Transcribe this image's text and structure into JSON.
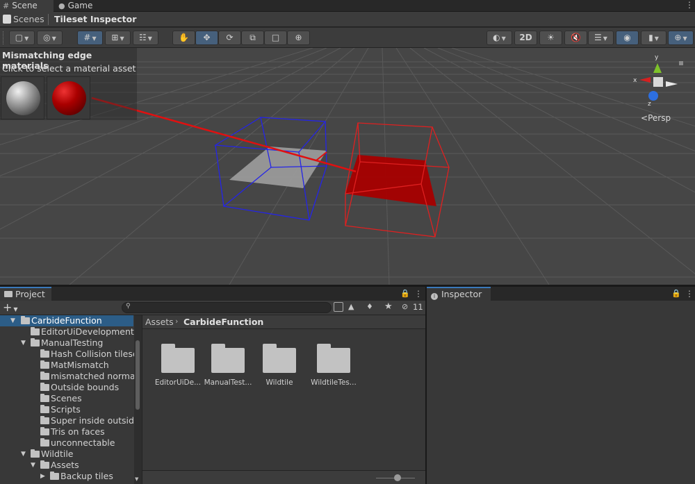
{
  "top_tabs": [
    {
      "label": "Scene",
      "icon": "grid-icon"
    },
    {
      "label": "Game",
      "icon": "gamepad-icon"
    }
  ],
  "breadcrumb": {
    "root": "Scenes",
    "current": "Tileset Inspector"
  },
  "toolbar": {
    "two_d_label": "2D"
  },
  "scene": {
    "overlay_title": "Mismatching edge materials",
    "overlay_subtitle": "Click to select a material asset",
    "persp_label": "Persp",
    "gizmo_axes": {
      "x": "x",
      "y": "y",
      "z": "z"
    },
    "colors": {
      "grid_bg": "#444444",
      "blue_box": "#2020e0",
      "red_box": "#e01a1a",
      "gray_face": "#9a9a9a",
      "red_face": "#b00000"
    }
  },
  "project": {
    "tab_label": "Project",
    "search_placeholder": "",
    "hidden_count": "11",
    "tree": [
      {
        "label": "CarbideFunction",
        "depth": 0,
        "arrow": "expanded",
        "selected": true
      },
      {
        "label": "EditorUiDevelopment",
        "depth": 1,
        "arrow": "none"
      },
      {
        "label": "ManualTesting",
        "depth": 1,
        "arrow": "expanded"
      },
      {
        "label": "Hash Collision tileset",
        "depth": 2,
        "arrow": "none"
      },
      {
        "label": "MatMismatch",
        "depth": 2,
        "arrow": "none"
      },
      {
        "label": "mismatched normals",
        "depth": 2,
        "arrow": "none"
      },
      {
        "label": "Outside bounds",
        "depth": 2,
        "arrow": "none"
      },
      {
        "label": "Scenes",
        "depth": 2,
        "arrow": "none"
      },
      {
        "label": "Scripts",
        "depth": 2,
        "arrow": "none"
      },
      {
        "label": "Super inside outside",
        "depth": 2,
        "arrow": "none"
      },
      {
        "label": "Tris on faces",
        "depth": 2,
        "arrow": "none"
      },
      {
        "label": "unconnectable",
        "depth": 2,
        "arrow": "none"
      },
      {
        "label": "Wildtile",
        "depth": 1,
        "arrow": "expanded"
      },
      {
        "label": "Assets",
        "depth": 2,
        "arrow": "expanded"
      },
      {
        "label": "Backup tiles",
        "depth": 3,
        "arrow": "collapsed"
      }
    ],
    "path": {
      "root": "Assets",
      "current": "CarbideFunction"
    },
    "assets": [
      "EditorUiDe...",
      "ManualTest...",
      "Wildtile",
      "WildtileTes..."
    ]
  },
  "inspector": {
    "tab_label": "Inspector"
  }
}
